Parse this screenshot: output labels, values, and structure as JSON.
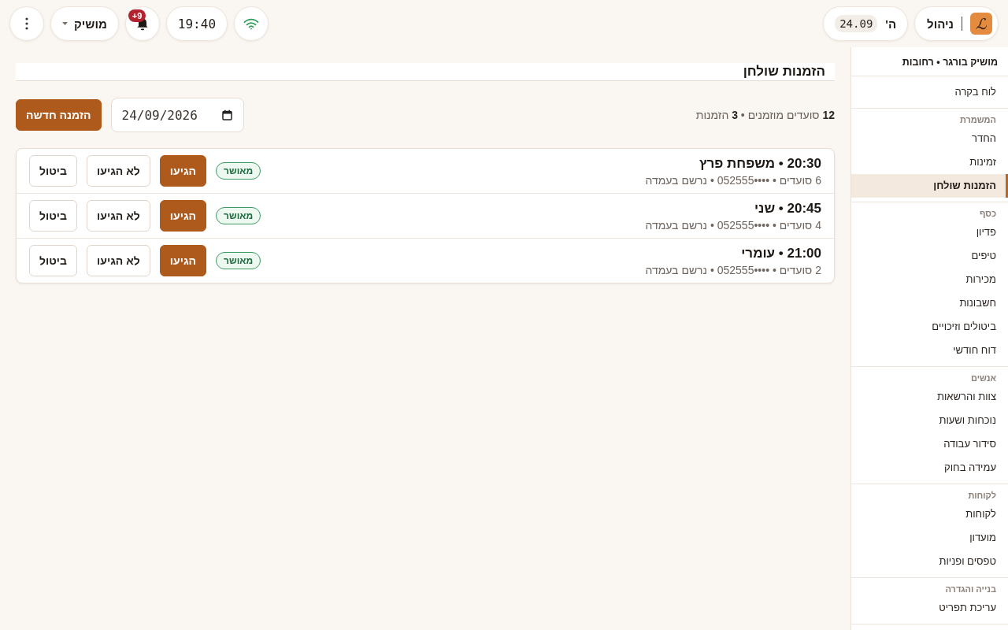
{
  "topbar": {
    "brand": {
      "logo_text": "ℒ",
      "label": "ניהול"
    },
    "date": {
      "weekday": "ה'",
      "day": "24.09"
    },
    "connection": {
      "online": true
    },
    "clock": "19:40",
    "notifications": {
      "badge": "+9"
    },
    "user": {
      "name": "מושיק"
    }
  },
  "sidebar": {
    "title": "מושיק בורגר • רחובות",
    "sections": [
      {
        "items": [
          {
            "label": "לוח בקרה",
            "selected": false
          }
        ]
      },
      {
        "label": "המשמרת",
        "items": [
          {
            "label": "החדר",
            "selected": false
          },
          {
            "label": "זמינות",
            "selected": false
          },
          {
            "label": "הזמנות שולחן",
            "selected": true
          }
        ]
      },
      {
        "label": "כסף",
        "items": [
          {
            "label": "פדיון",
            "selected": false
          },
          {
            "label": "טיפים",
            "selected": false
          },
          {
            "label": "מכירות",
            "selected": false
          },
          {
            "label": "חשבונות",
            "selected": false
          },
          {
            "label": "ביטולים וזיכויים",
            "selected": false
          },
          {
            "label": "דוח חודשי",
            "selected": false
          }
        ]
      },
      {
        "label": "אנשים",
        "items": [
          {
            "label": "צוות והרשאות",
            "selected": false
          },
          {
            "label": "נוכחות ושעות",
            "selected": false
          },
          {
            "label": "סידור עבודה",
            "selected": false
          },
          {
            "label": "עמידה בחוק",
            "selected": false
          }
        ]
      },
      {
        "label": "לקוחות",
        "items": [
          {
            "label": "לקוחות",
            "selected": false
          },
          {
            "label": "מועדון",
            "selected": false
          },
          {
            "label": "טפסים ופניות",
            "selected": false
          }
        ]
      },
      {
        "label": "בנייה והגדרה",
        "items": [
          {
            "label": "עריכת תפריט",
            "selected": false
          }
        ]
      }
    ]
  },
  "main": {
    "title": "הזמנות שולחן",
    "summary": "**12** סועדים מוזמנים • **3** הזמנות",
    "date_field": {
      "value": "24/09/2026"
    },
    "new_button": "הזמנה חדשה",
    "reservations": [
      {
        "title": "20:30 • משפחת פרץ",
        "details": "6 סועדים • ••••052555 • נרשם בעמדה",
        "status": {
          "label": "מאושר",
          "kind": "confirmed"
        },
        "actions": [
          {
            "label": "הגיעו",
            "kind": "primary"
          },
          {
            "label": "לא הגיעו",
            "kind": "secondary"
          },
          {
            "label": "ביטול",
            "kind": "secondary"
          }
        ]
      },
      {
        "title": "20:45 • שני",
        "details": "4 סועדים • ••••052555 • נרשם בעמדה",
        "status": {
          "label": "מאושר",
          "kind": "confirmed"
        },
        "actions": [
          {
            "label": "הגיעו",
            "kind": "primary"
          },
          {
            "label": "לא הגיעו",
            "kind": "secondary"
          },
          {
            "label": "ביטול",
            "kind": "secondary"
          }
        ]
      },
      {
        "title": "21:00 • עומרי",
        "details": "2 סועדים • ••••052555 • נרשם בעמדה",
        "status": {
          "label": "מאושר",
          "kind": "confirmed"
        },
        "actions": [
          {
            "label": "הגיעו",
            "kind": "primary"
          },
          {
            "label": "לא הגיעו",
            "kind": "secondary"
          },
          {
            "label": "ביטול",
            "kind": "secondary"
          }
        ]
      }
    ]
  }
}
